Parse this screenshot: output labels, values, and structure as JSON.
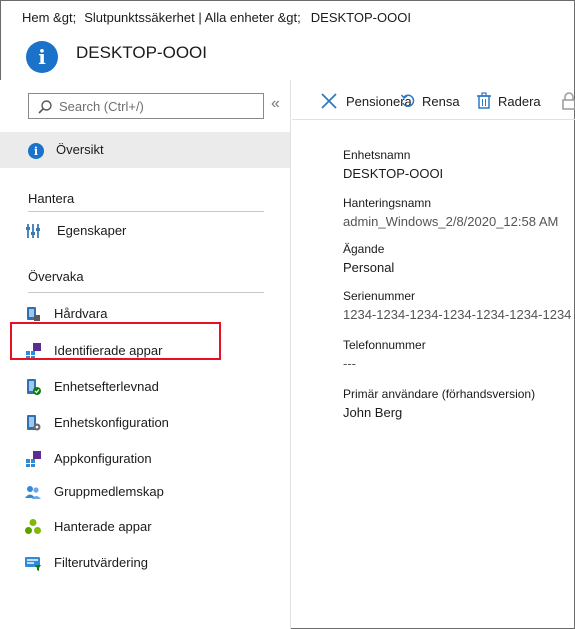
{
  "breadcrumb": {
    "home": "Hem &gt;",
    "middle": "Slutpunktssäkerhet | Alla enheter &gt;",
    "current": "DESKTOP-OOOI"
  },
  "header": {
    "title": "DESKTOP-OOOI",
    "icon": "info-icon"
  },
  "search": {
    "placeholder": "Search (Ctrl+/)"
  },
  "collapse_glyph": "«",
  "nav": {
    "overview": "Översikt",
    "manage_heading": "Hantera",
    "manage_items": [
      "Egenskaper"
    ],
    "monitor_heading": "Övervaka",
    "monitor_items": [
      "Hårdvara",
      "Identifierade appar",
      "Enhetsefterlevnad",
      "Enhetskonfiguration",
      "Appkonfiguration",
      "Gruppmedlemskap",
      "Hanterade appar",
      "Filterutvärdering"
    ]
  },
  "toolbar": {
    "retire": "Pensionera",
    "wipe": "Rensa",
    "delete": "Radera"
  },
  "properties": [
    {
      "label": "Enhetsnamn",
      "value": "DESKTOP-OOOI"
    },
    {
      "label": "Hanteringsnamn",
      "value": "admin_Windows_2/8/2020_12:58 AM"
    },
    {
      "label": "Ägande",
      "value": "Personal"
    },
    {
      "label": "Serienummer",
      "value": "1234-1234-1234-1234-1234-1234-1234"
    },
    {
      "label": "Telefonnummer",
      "value": "---"
    },
    {
      "label": "Primär användare (förhandsversion)",
      "value": "John Berg"
    }
  ],
  "colors": {
    "accent": "#1a73c9",
    "highlight": "#e81123",
    "selected_bg": "#ebebeb"
  }
}
